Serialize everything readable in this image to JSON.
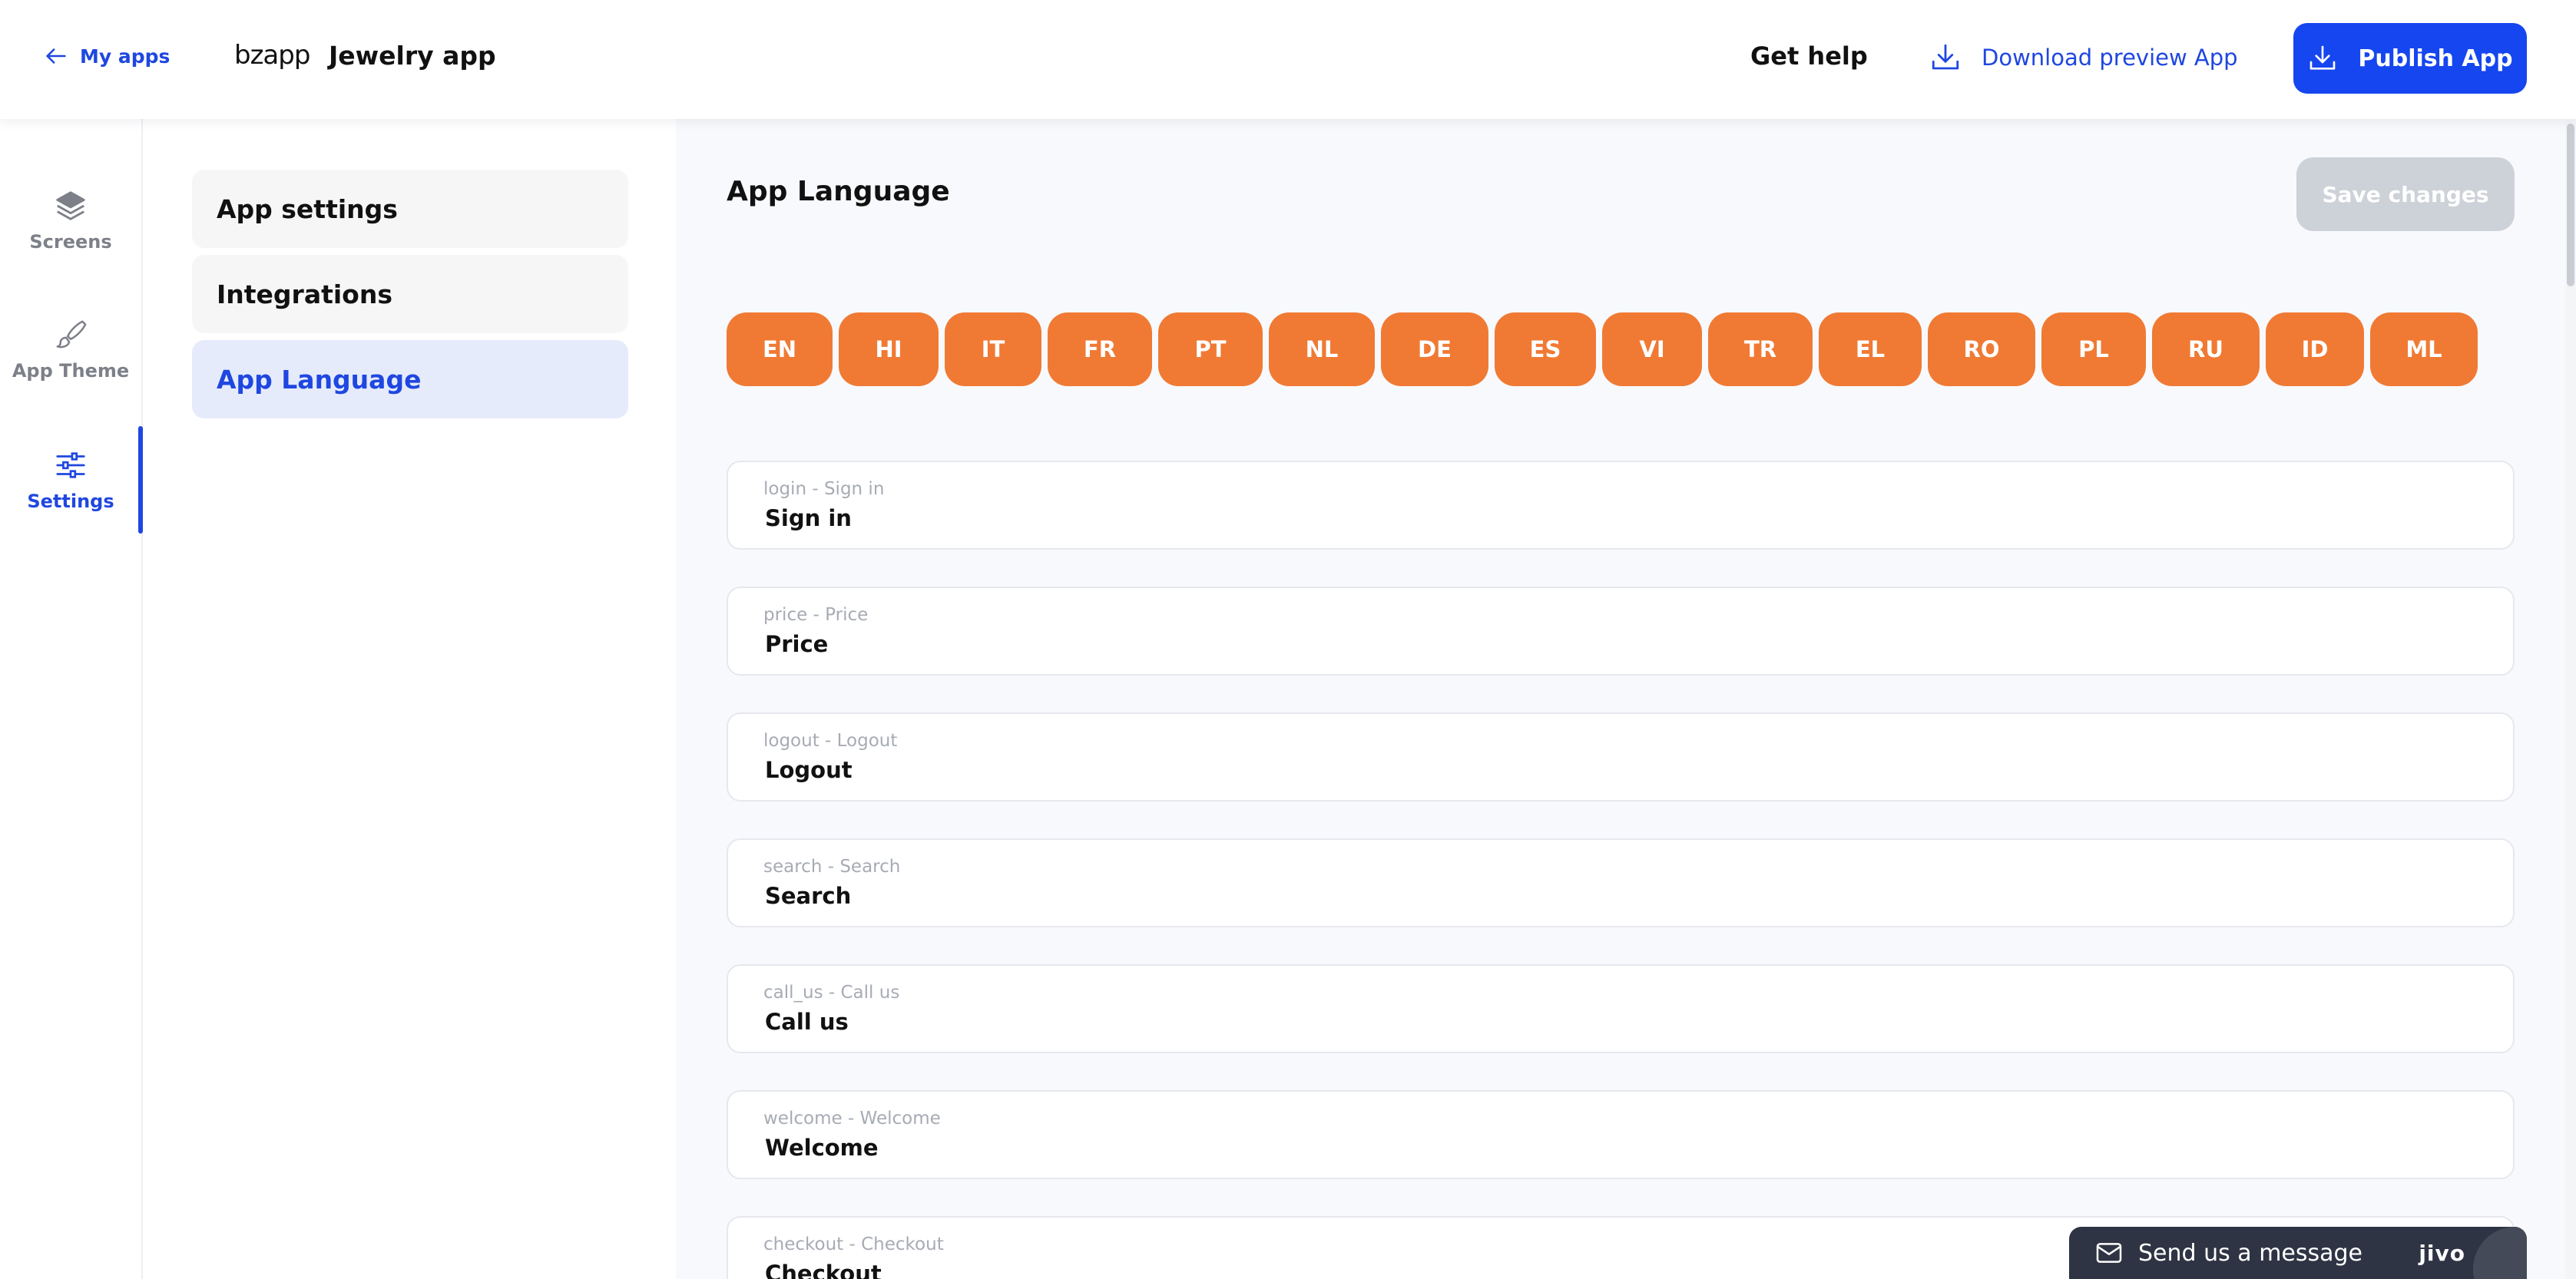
{
  "header": {
    "back_label": "My apps",
    "logo_text": "bzapp",
    "app_name": "Jewelry app",
    "help_label": "Get help",
    "download_label": "Download preview App",
    "publish_label": "Publish App"
  },
  "nav": [
    {
      "label": "Screens",
      "icon": "layers-icon"
    },
    {
      "label": "App Theme",
      "icon": "brush-icon"
    },
    {
      "label": "Settings",
      "icon": "sliders-icon",
      "active": true
    }
  ],
  "menu": [
    {
      "label": "App settings"
    },
    {
      "label": "Integrations"
    },
    {
      "label": "App Language",
      "active": true
    }
  ],
  "main": {
    "title": "App Language",
    "save_label": "Save changes",
    "languages": [
      "EN",
      "HI",
      "IT",
      "FR",
      "PT",
      "NL",
      "DE",
      "ES",
      "VI",
      "TR",
      "EL",
      "RO",
      "PL",
      "RU",
      "ID",
      "ML"
    ],
    "fields": [
      {
        "key": "login - Sign in",
        "value": "Sign in"
      },
      {
        "key": "price - Price",
        "value": "Price"
      },
      {
        "key": "logout - Logout",
        "value": "Logout"
      },
      {
        "key": "search - Search",
        "value": "Search"
      },
      {
        "key": "call_us - Call us",
        "value": "Call us"
      },
      {
        "key": "welcome - Welcome",
        "value": "Welcome"
      },
      {
        "key": "checkout - Checkout",
        "value": "Checkout"
      }
    ]
  },
  "chat": {
    "label": "Send us a message",
    "brand": "jivo"
  },
  "colors": {
    "accent": "#1546ef",
    "language_pill": "#f07a34",
    "save_disabled": "#cdd1d8"
  }
}
